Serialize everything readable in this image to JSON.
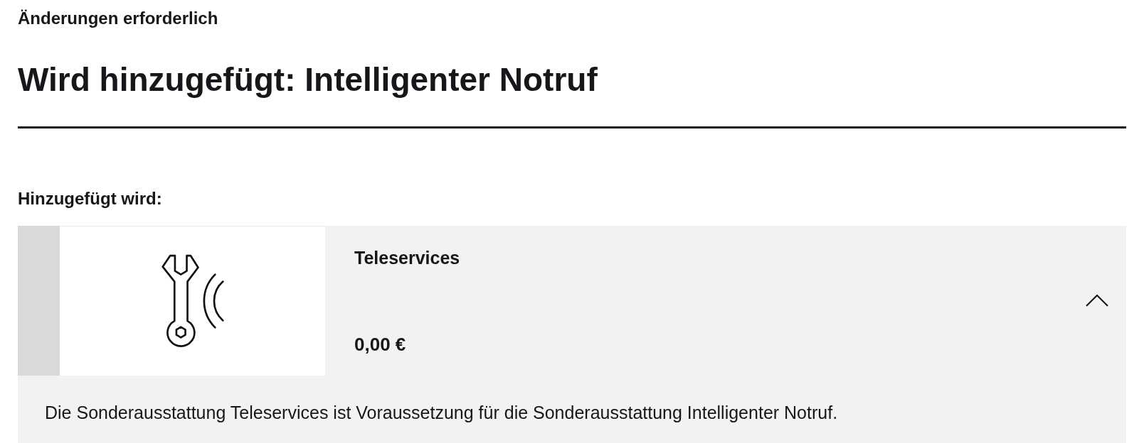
{
  "header": {
    "label": "Änderungen erforderlich",
    "title": "Wird hinzugefügt: Intelligenter Notruf"
  },
  "section": {
    "heading": "Hinzugefügt wird:",
    "items": [
      {
        "name": "Teleservices",
        "price": "0,00 €",
        "expanded": true,
        "description": "Die Sonderausstattung Teleservices ist Voraussetzung für die Sonderausstattung Intelligenter Notruf."
      }
    ]
  }
}
